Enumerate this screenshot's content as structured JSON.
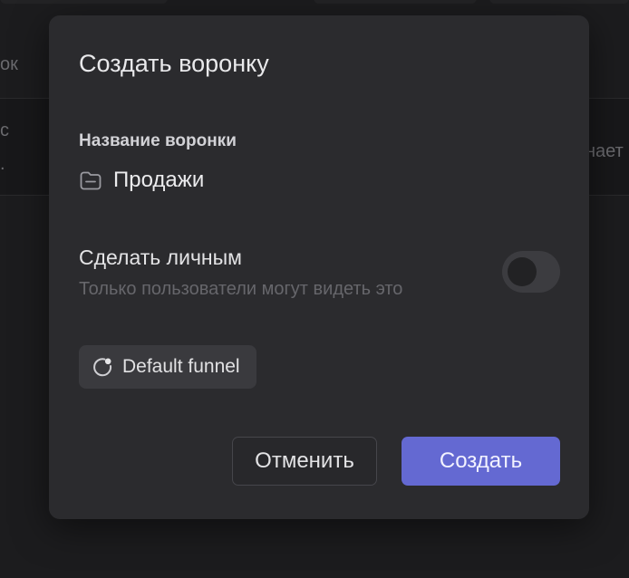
{
  "background": {
    "column_header_fragment": "ок",
    "row_text_a": "с",
    "row_text_b": ".",
    "right_fragment": "нает"
  },
  "modal": {
    "title": "Создать воронку",
    "name_label": "Название воронки",
    "name_value": "Продажи",
    "private_title": "Сделать личным",
    "private_subtitle": "Только пользователи могут видеть это",
    "private_enabled": false,
    "template_label": "Default funnel",
    "cancel_label": "Отменить",
    "create_label": "Создать"
  },
  "colors": {
    "accent": "#6469d2",
    "modal_bg": "#2b2b2e",
    "page_bg": "#1c1c1e"
  },
  "icons": {
    "name_field": "folder-icon",
    "template_chip": "funnel-spinner-icon"
  }
}
